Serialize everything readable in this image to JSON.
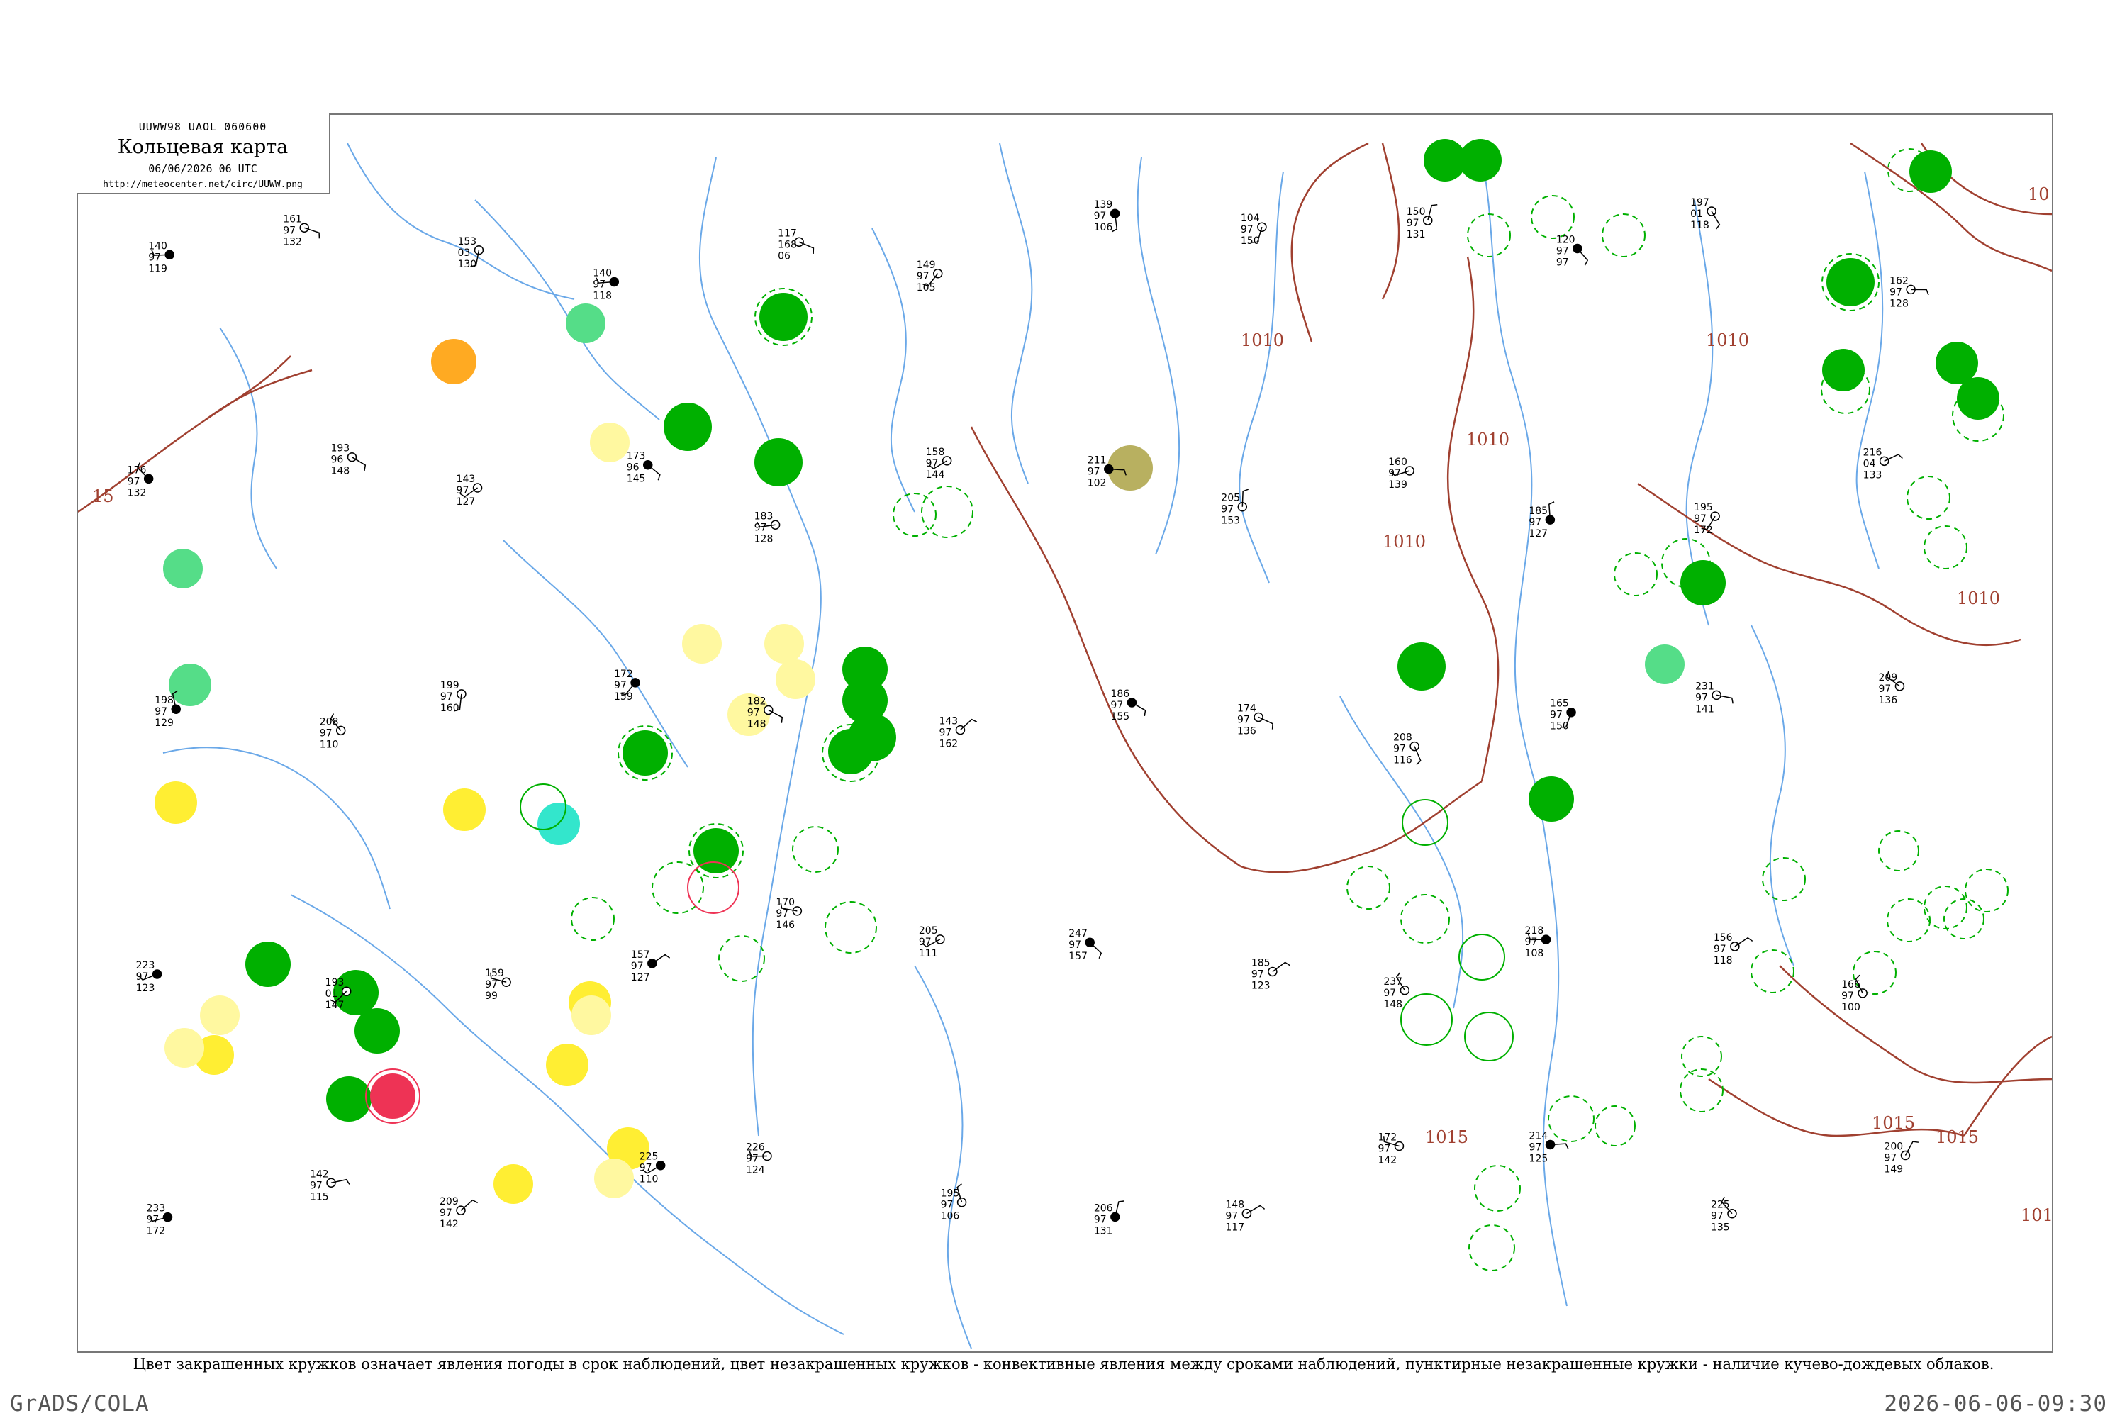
{
  "header": {
    "code": "UUWW98  UAOL  060600",
    "title": "Кольцевая карта",
    "date": "06/06/2026 06 UTC",
    "url": "http://meteocenter.net/circ/UUWW.png"
  },
  "legend_text": "Цвет закрашенных кружков означает явления погоды в срок наблюдений, цвет незакрашенных кружков - конвективные явления между сроками наблюдений, пунктирные незакрашенные кружки - наличие кучево-дождевых облаков.",
  "footer": {
    "software": "GrADS/COLA",
    "timestamp": "2026-06-06-09:30"
  },
  "isobar_labels": [
    "15",
    "1010",
    "1010",
    "1010",
    "1015",
    "1015",
    "1015",
    "1010",
    "1010",
    "10",
    "101"
  ],
  "colors": {
    "rain_green": "#00b000",
    "shower_light_green": "#55dd88",
    "drizzle_yellow": "#ffee33",
    "haze_light_yellow": "#fff8a0",
    "fog_orange": "#ffaa22",
    "thunder_red": "#ee3355",
    "cyan": "#33e6cc",
    "khaki": "#b8b060",
    "isobar": "#a04030",
    "river": "#6aa8e8",
    "station": "#000000"
  },
  "station_samples": [
    {
      "p": "140",
      "t": "97",
      "n": "119"
    },
    {
      "p": "161",
      "t": "97",
      "n": "132"
    },
    {
      "p": "153",
      "t": "03",
      "n": "130"
    },
    {
      "p": "140",
      "t": "97",
      "n": "118"
    },
    {
      "p": "117",
      "t": "168",
      "n": "06"
    },
    {
      "p": "149",
      "t": "97",
      "n": "105"
    },
    {
      "p": "139",
      "t": "97",
      "n": "106"
    },
    {
      "p": "104",
      "t": "97",
      "n": "150"
    },
    {
      "p": "150",
      "t": "97",
      "n": "131"
    },
    {
      "p": "120",
      "t": "97",
      "n": "97"
    },
    {
      "p": "197",
      "t": "01",
      "n": "118"
    },
    {
      "p": "162",
      "t": "97",
      "n": "128"
    },
    {
      "p": "176",
      "t": "97",
      "n": "132"
    },
    {
      "p": "193",
      "t": "96",
      "n": "148"
    },
    {
      "p": "143",
      "t": "97",
      "n": "127"
    },
    {
      "p": "173",
      "t": "96",
      "n": "145"
    },
    {
      "p": "183",
      "t": "97",
      "n": "128"
    },
    {
      "p": "158",
      "t": "97",
      "n": "144"
    },
    {
      "p": "211",
      "t": "97",
      "n": "102"
    },
    {
      "p": "205",
      "t": "97",
      "n": "153"
    },
    {
      "p": "160",
      "t": "97",
      "n": "139"
    },
    {
      "p": "185",
      "t": "97",
      "n": "127"
    },
    {
      "p": "195",
      "t": "97",
      "n": "172"
    },
    {
      "p": "216",
      "t": "04",
      "n": "133"
    },
    {
      "p": "198",
      "t": "97",
      "n": "129"
    },
    {
      "p": "208",
      "t": "97",
      "n": "110"
    },
    {
      "p": "199",
      "t": "97",
      "n": "160"
    },
    {
      "p": "172",
      "t": "97",
      "n": "159"
    },
    {
      "p": "182",
      "t": "97",
      "n": "148"
    },
    {
      "p": "143",
      "t": "97",
      "n": "162"
    },
    {
      "p": "186",
      "t": "97",
      "n": "155"
    },
    {
      "p": "174",
      "t": "97",
      "n": "136"
    },
    {
      "p": "208",
      "t": "97",
      "n": "116"
    },
    {
      "p": "165",
      "t": "97",
      "n": "150"
    },
    {
      "p": "231",
      "t": "97",
      "n": "141"
    },
    {
      "p": "209",
      "t": "97",
      "n": "136"
    },
    {
      "p": "223",
      "t": "97",
      "n": "123"
    },
    {
      "p": "193",
      "t": "01",
      "n": "147"
    },
    {
      "p": "159",
      "t": "97",
      "n": "99"
    },
    {
      "p": "157",
      "t": "97",
      "n": "127"
    },
    {
      "p": "170",
      "t": "97",
      "n": "146"
    },
    {
      "p": "205",
      "t": "97",
      "n": "111"
    },
    {
      "p": "247",
      "t": "97",
      "n": "157"
    },
    {
      "p": "185",
      "t": "97",
      "n": "123"
    },
    {
      "p": "237",
      "t": "97",
      "n": "148"
    },
    {
      "p": "218",
      "t": "97",
      "n": "108"
    },
    {
      "p": "156",
      "t": "97",
      "n": "118"
    },
    {
      "p": "166",
      "t": "97",
      "n": "100"
    },
    {
      "p": "233",
      "t": "97",
      "n": "172"
    },
    {
      "p": "142",
      "t": "97",
      "n": "115"
    },
    {
      "p": "209",
      "t": "97",
      "n": "142"
    },
    {
      "p": "225",
      "t": "97",
      "n": "110"
    },
    {
      "p": "226",
      "t": "97",
      "n": "124"
    },
    {
      "p": "195",
      "t": "97",
      "n": "106"
    },
    {
      "p": "206",
      "t": "97",
      "n": "131"
    },
    {
      "p": "148",
      "t": "97",
      "n": "117"
    },
    {
      "p": "172",
      "t": "97",
      "n": "142"
    },
    {
      "p": "214",
      "t": "97",
      "n": "125"
    },
    {
      "p": "225",
      "t": "97",
      "n": "135"
    },
    {
      "p": "200",
      "t": "97",
      "n": "149"
    }
  ]
}
